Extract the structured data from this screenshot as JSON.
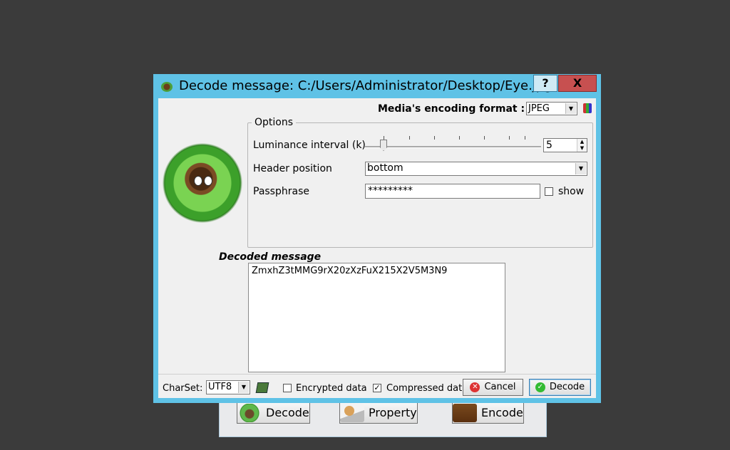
{
  "background_app": {
    "buttons": [
      {
        "label": "Decode",
        "icon": "decode-icon"
      },
      {
        "label": "Property",
        "icon": "property-icon"
      },
      {
        "label": "Encode",
        "icon": "encode-icon"
      }
    ]
  },
  "dialog": {
    "title": "Decode message: C:/Users/Administrator/Desktop/Eye.jpg",
    "help_label": "?",
    "close_label": "X",
    "accent_color": "#5fc2e6",
    "encoding_format_label": "Media's encoding format :",
    "encoding_format_value": "JPEG",
    "options": {
      "legend": "Options",
      "luminance_label": "Luminance interval (k)",
      "luminance_value": "5",
      "header_position_label": "Header position",
      "header_position_value": "bottom",
      "passphrase_label": "Passphrase",
      "passphrase_value": "*********",
      "show_label": "show",
      "show_checked": false
    },
    "decoded_message_label": "Decoded message",
    "decoded_message": "ZmxhZ3tMMG9rX20zXzFuX215X2V5M3N9",
    "footer": {
      "charset_label": "CharSet:",
      "charset_value": "UTF8",
      "encrypted_label": "Encrypted data",
      "encrypted_checked": false,
      "compressed_label": "Compressed dat",
      "compressed_checked": true,
      "cancel_label": "Cancel",
      "decode_label": "Decode"
    }
  }
}
